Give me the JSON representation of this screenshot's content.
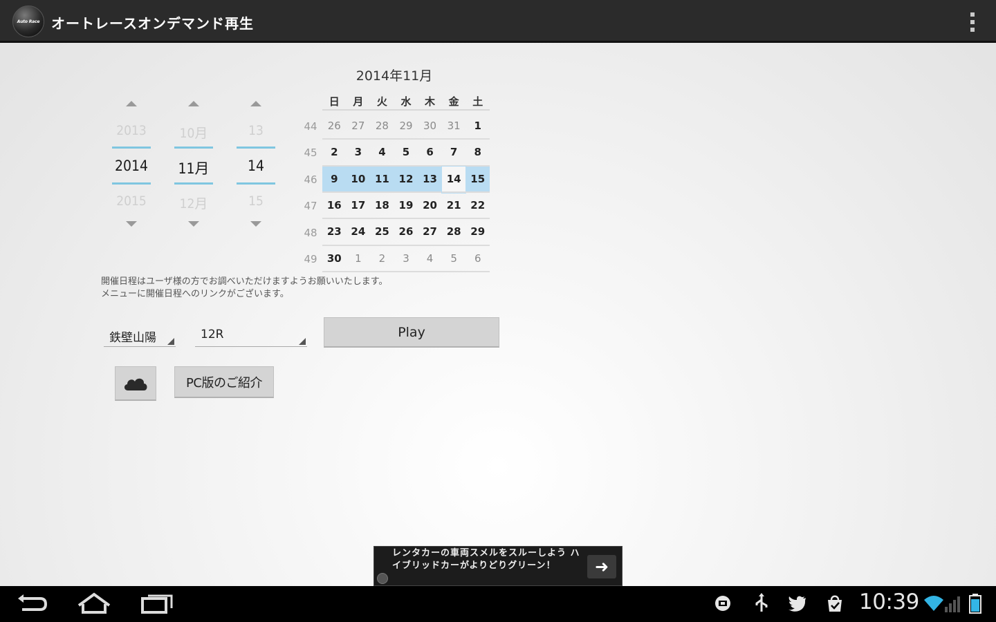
{
  "app": {
    "logo_text": "Auto Race",
    "title": "オートレースオンデマンド再生"
  },
  "pickers": {
    "year": {
      "prev": "2013",
      "current": "2014",
      "next": "2015"
    },
    "month": {
      "prev": "10月",
      "current": "11月",
      "next": "12月"
    },
    "day": {
      "prev": "13",
      "current": "14",
      "next": "15"
    }
  },
  "calendar": {
    "title": "2014年11月",
    "weekdays": [
      "日",
      "月",
      "火",
      "水",
      "木",
      "金",
      "土"
    ],
    "week_numbers": [
      "44",
      "45",
      "46",
      "47",
      "48",
      "49"
    ],
    "weeks": [
      [
        "26",
        "27",
        "28",
        "29",
        "30",
        "31",
        "1"
      ],
      [
        "2",
        "3",
        "4",
        "5",
        "6",
        "7",
        "8"
      ],
      [
        "9",
        "10",
        "11",
        "12",
        "13",
        "14",
        "15"
      ],
      [
        "16",
        "17",
        "18",
        "19",
        "20",
        "21",
        "22"
      ],
      [
        "23",
        "24",
        "25",
        "26",
        "27",
        "28",
        "29"
      ],
      [
        "30",
        "1",
        "2",
        "3",
        "4",
        "5",
        "6"
      ]
    ],
    "selected_date": "14"
  },
  "notice": {
    "line1": "開催日程はユーザ様の方でお調べいただけますようお願いいたします。",
    "line2": "メニューに開催日程へのリンクがございます。"
  },
  "controls": {
    "venue_value": "鉄壁山陽",
    "race_value": "12R",
    "play_label": "Play",
    "pc_label": "PC版のご紹介"
  },
  "ad": {
    "text": "レンタカーの車両スメルをスルーしよう ハイブリッドカーがよりどりグリーン！",
    "arrow": "➜"
  },
  "status": {
    "time": "10:39"
  },
  "colors": {
    "actionbar": "#2b2b2b",
    "picker_accent": "#7fc6e0",
    "selection": "#b9dcf2"
  }
}
